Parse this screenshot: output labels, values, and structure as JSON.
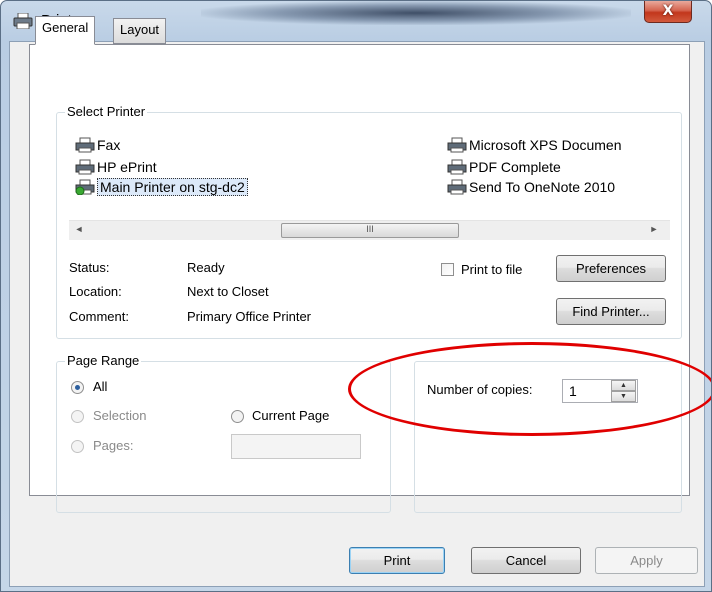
{
  "window": {
    "title": "Print",
    "close_glyph": "X"
  },
  "tabs": [
    {
      "label": "General"
    },
    {
      "label": "Layout"
    }
  ],
  "select_printer": {
    "label": "Select Printer",
    "printers": [
      {
        "name": "Fax"
      },
      {
        "name": "HP ePrint"
      },
      {
        "name": "Main Printer on stg-dc2",
        "selected": true
      },
      {
        "name": "Microsoft XPS Documen"
      },
      {
        "name": "PDF Complete"
      },
      {
        "name": "Send To OneNote 2010"
      }
    ],
    "scroll_thumb_glyph": "III",
    "scroll_left_glyph": "◄",
    "scroll_right_glyph": "►",
    "status_label": "Status:",
    "status_value": "Ready",
    "location_label": "Location:",
    "location_value": "Next to Closet",
    "comment_label": "Comment:",
    "comment_value": "Primary Office Printer",
    "print_to_file_label": "Print to file",
    "preferences_label": "Preferences",
    "find_printer_label": "Find Printer..."
  },
  "page_range": {
    "label": "Page Range",
    "all_label": "All",
    "selection_label": "Selection",
    "current_page_label": "Current Page",
    "pages_label": "Pages:"
  },
  "copies": {
    "label": "Number of copies:",
    "value": "1",
    "up_glyph": "▲",
    "down_glyph": "▼"
  },
  "buttons": {
    "print": "Print",
    "cancel": "Cancel",
    "apply": "Apply"
  },
  "annotation": {
    "color": "#e00000"
  }
}
